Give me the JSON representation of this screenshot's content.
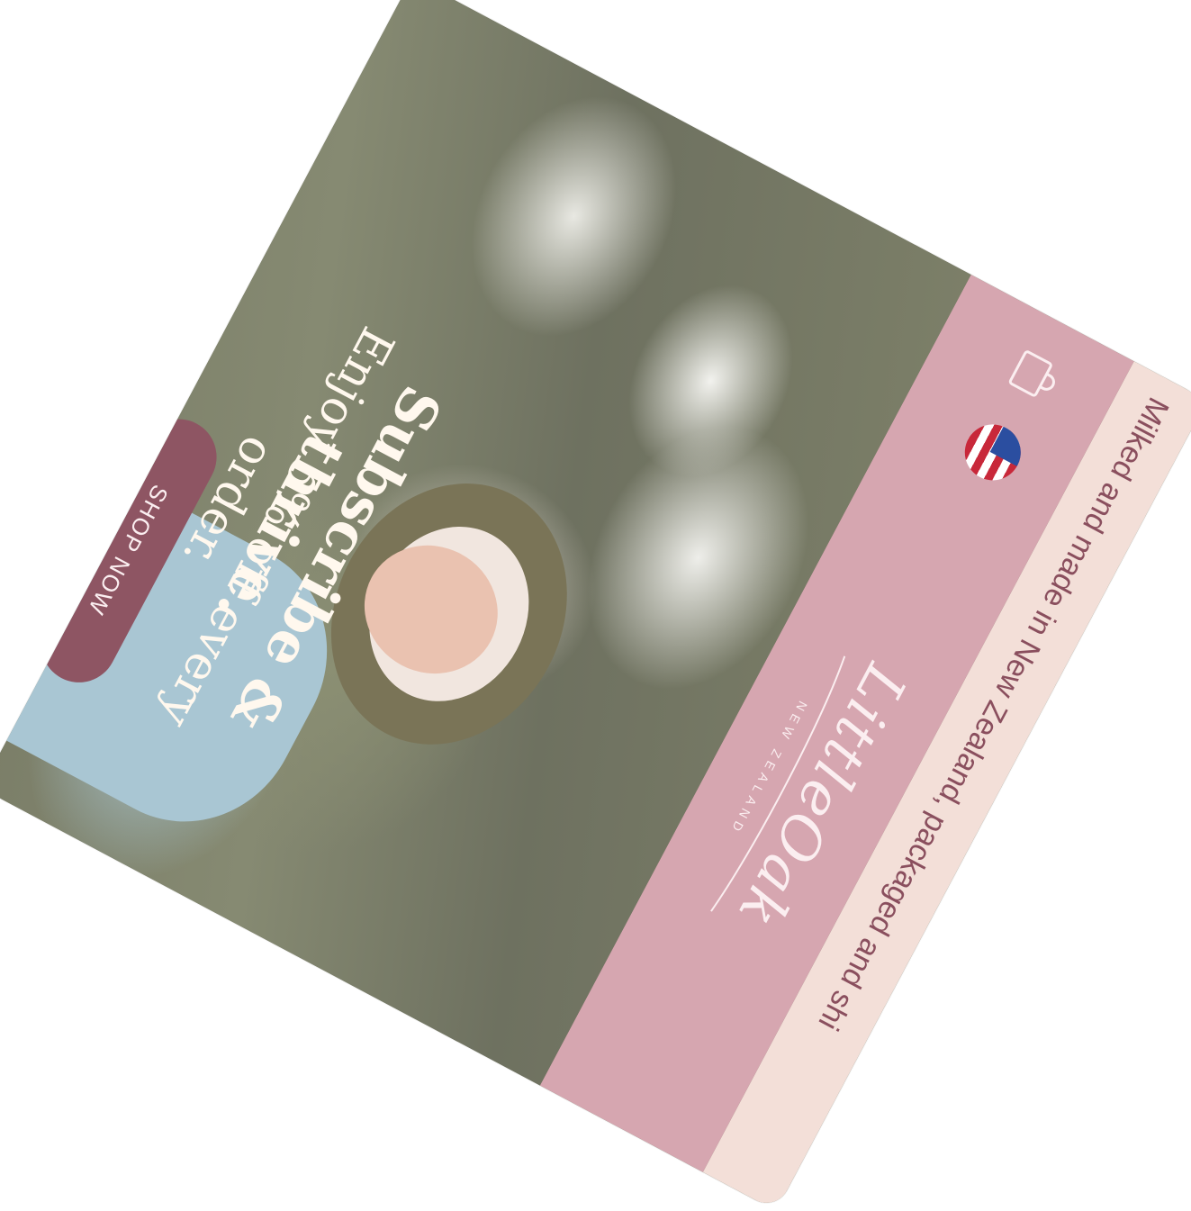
{
  "announcement": {
    "text": "Milked and made in New Zealand, packaged and shi"
  },
  "header": {
    "logo_script": "LittleOak",
    "logo_sub": "NEW ZEALAND",
    "menu_icon": "hamburger-icon",
    "flag_icon": "us-flag-icon",
    "cart_icon": "cart-icon"
  },
  "hero": {
    "title": "Subscribe & thrive.",
    "subtitle": "Enjoy 5% off every order.",
    "button_label": "SHOP NOW"
  },
  "colors": {
    "announcement_bg": "#f3dfd8",
    "header_bg": "#d6a6b0",
    "button_bg": "#8e5563",
    "text_light": "#fbeef0"
  }
}
